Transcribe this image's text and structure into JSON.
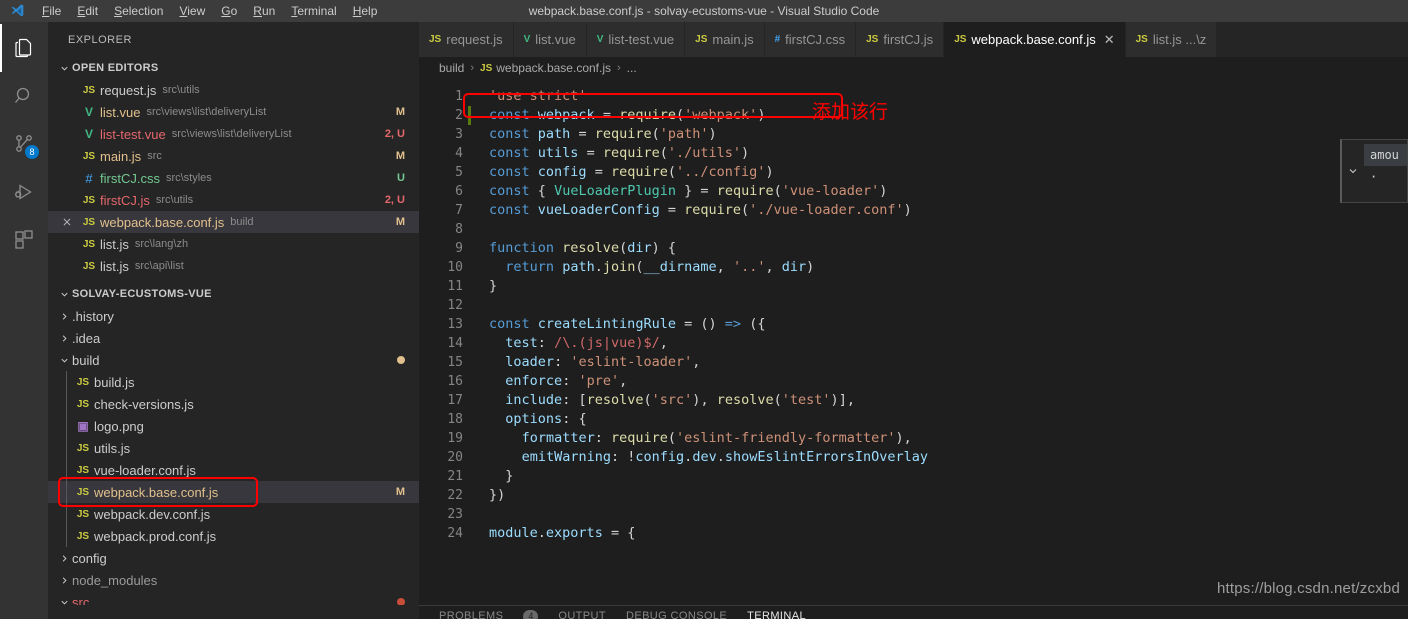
{
  "titlebar": {
    "title": "webpack.base.conf.js - solvay-ecustoms-vue - Visual Studio Code",
    "menus": [
      {
        "label": "File",
        "mnemonic": "F"
      },
      {
        "label": "Edit",
        "mnemonic": "E"
      },
      {
        "label": "Selection",
        "mnemonic": "S"
      },
      {
        "label": "View",
        "mnemonic": "V"
      },
      {
        "label": "Go",
        "mnemonic": "G"
      },
      {
        "label": "Run",
        "mnemonic": "R"
      },
      {
        "label": "Terminal",
        "mnemonic": "T"
      },
      {
        "label": "Help",
        "mnemonic": "H"
      }
    ]
  },
  "activitybar": {
    "items": [
      {
        "name": "explorer-icon",
        "label": "Explorer",
        "active": true,
        "badge": ""
      },
      {
        "name": "search-icon",
        "label": "Search",
        "active": false,
        "badge": ""
      },
      {
        "name": "source-control-icon",
        "label": "Source Control",
        "active": false,
        "badge": "8"
      },
      {
        "name": "run-debug-icon",
        "label": "Run and Debug",
        "active": false,
        "badge": ""
      },
      {
        "name": "extensions-icon",
        "label": "Extensions",
        "active": false,
        "badge": ""
      }
    ]
  },
  "sidebar": {
    "title": "EXPLORER",
    "open_editors": {
      "header": "OPEN EDITORS",
      "items": [
        {
          "icon": "js",
          "name": "request.js",
          "path": "src\\utils",
          "status": "",
          "status_kind": "",
          "name_kind": "",
          "selected": false
        },
        {
          "icon": "vue",
          "name": "list.vue",
          "path": "src\\views\\list\\deliveryList",
          "status": "M",
          "status_kind": "M",
          "name_kind": "mod",
          "selected": false
        },
        {
          "icon": "vue",
          "name": "list-test.vue",
          "path": "src\\views\\list\\deliveryList",
          "status": "2, U",
          "status_kind": "C",
          "name_kind": "conflict",
          "selected": false
        },
        {
          "icon": "js",
          "name": "main.js",
          "path": "src",
          "status": "M",
          "status_kind": "M",
          "name_kind": "mod",
          "selected": false
        },
        {
          "icon": "css",
          "name": "firstCJ.css",
          "path": "src\\styles",
          "status": "U",
          "status_kind": "U",
          "name_kind": "untracked",
          "selected": false
        },
        {
          "icon": "js",
          "name": "firstCJ.js",
          "path": "src\\utils",
          "status": "2, U",
          "status_kind": "C",
          "name_kind": "conflict",
          "selected": false
        },
        {
          "icon": "js",
          "name": "webpack.base.conf.js",
          "path": "build",
          "status": "M",
          "status_kind": "M",
          "name_kind": "mod",
          "selected": true
        },
        {
          "icon": "js",
          "name": "list.js",
          "path": "src\\lang\\zh",
          "status": "",
          "status_kind": "",
          "name_kind": "",
          "selected": false
        },
        {
          "icon": "js",
          "name": "list.js",
          "path": "src\\api\\list",
          "status": "",
          "status_kind": "",
          "name_kind": "",
          "selected": false
        }
      ]
    },
    "project": {
      "header": "SOLVAY-ECUSTOMS-VUE",
      "items": [
        {
          "type": "folder",
          "name": "history_dot_folder",
          "label": ".history",
          "expanded": false,
          "depth": 1,
          "dot": "",
          "name_kind": ""
        },
        {
          "type": "folder",
          "name": "idea-folder",
          "label": ".idea",
          "expanded": false,
          "depth": 1,
          "dot": "",
          "name_kind": ""
        },
        {
          "type": "folder",
          "name": "build-folder",
          "label": "build",
          "expanded": true,
          "depth": 1,
          "dot": "#e2c08d",
          "name_kind": ""
        },
        {
          "type": "file",
          "icon": "js",
          "label": "build.js",
          "depth": 2,
          "status": "",
          "status_kind": "",
          "name_kind": "",
          "selected": false
        },
        {
          "type": "file",
          "icon": "js",
          "label": "check-versions.js",
          "depth": 2,
          "status": "",
          "status_kind": "",
          "name_kind": "",
          "selected": false
        },
        {
          "type": "file",
          "icon": "png",
          "label": "logo.png",
          "depth": 2,
          "status": "",
          "status_kind": "",
          "name_kind": "",
          "selected": false
        },
        {
          "type": "file",
          "icon": "js",
          "label": "utils.js",
          "depth": 2,
          "status": "",
          "status_kind": "",
          "name_kind": "",
          "selected": false
        },
        {
          "type": "file",
          "icon": "js",
          "label": "vue-loader.conf.js",
          "depth": 2,
          "status": "",
          "status_kind": "",
          "name_kind": "",
          "selected": false
        },
        {
          "type": "file",
          "icon": "js",
          "label": "webpack.base.conf.js",
          "depth": 2,
          "status": "M",
          "status_kind": "M",
          "name_kind": "mod",
          "selected": true
        },
        {
          "type": "file",
          "icon": "js",
          "label": "webpack.dev.conf.js",
          "depth": 2,
          "status": "",
          "status_kind": "",
          "name_kind": "",
          "selected": false
        },
        {
          "type": "file",
          "icon": "js",
          "label": "webpack.prod.conf.js",
          "depth": 2,
          "status": "",
          "status_kind": "",
          "name_kind": "",
          "selected": false
        },
        {
          "type": "folder",
          "name": "config-folder",
          "label": "config",
          "expanded": false,
          "depth": 1,
          "dot": "",
          "name_kind": ""
        },
        {
          "type": "folder",
          "name": "node-modules-folder",
          "label": "node_modules",
          "expanded": false,
          "depth": 1,
          "dot": "",
          "name_kind": "dim"
        },
        {
          "type": "folder",
          "name": "src-folder",
          "label": "src",
          "expanded": true,
          "depth": 1,
          "dot": "#c74e39",
          "name_kind": "red"
        }
      ]
    }
  },
  "tabs": [
    {
      "icon": "js",
      "label": "request.js",
      "active": false,
      "close": false
    },
    {
      "icon": "vue",
      "label": "list.vue",
      "active": false,
      "close": false
    },
    {
      "icon": "vue",
      "label": "list-test.vue",
      "active": false,
      "close": false
    },
    {
      "icon": "js",
      "label": "main.js",
      "active": false,
      "close": false
    },
    {
      "icon": "css",
      "label": "firstCJ.css",
      "active": false,
      "close": false
    },
    {
      "icon": "js",
      "label": "firstCJ.js",
      "active": false,
      "close": false
    },
    {
      "icon": "js",
      "label": "webpack.base.conf.js",
      "active": true,
      "close": true
    },
    {
      "icon": "js",
      "label": "list.js ...\\z",
      "active": false,
      "close": false
    }
  ],
  "breadcrumb": {
    "root": "build",
    "file": "webpack.base.conf.js",
    "tail": "...",
    "separator": "›"
  },
  "code": {
    "lines": [
      {
        "n": 1,
        "added": false,
        "text": "'use strict'"
      },
      {
        "n": 2,
        "added": true,
        "text": "const webpack = require('webpack')"
      },
      {
        "n": 3,
        "added": false,
        "text": "const path = require('path')"
      },
      {
        "n": 4,
        "added": false,
        "text": "const utils = require('./utils')"
      },
      {
        "n": 5,
        "added": false,
        "text": "const config = require('../config')"
      },
      {
        "n": 6,
        "added": false,
        "text": "const { VueLoaderPlugin } = require('vue-loader')"
      },
      {
        "n": 7,
        "added": false,
        "text": "const vueLoaderConfig = require('./vue-loader.conf')"
      },
      {
        "n": 8,
        "added": false,
        "text": ""
      },
      {
        "n": 9,
        "added": false,
        "text": "function resolve(dir) {"
      },
      {
        "n": 10,
        "added": false,
        "text": "  return path.join(__dirname, '..', dir)"
      },
      {
        "n": 11,
        "added": false,
        "text": "}"
      },
      {
        "n": 12,
        "added": false,
        "text": ""
      },
      {
        "n": 13,
        "added": false,
        "text": "const createLintingRule = () => ({"
      },
      {
        "n": 14,
        "added": false,
        "text": "  test: /\\.(js|vue)$/,"
      },
      {
        "n": 15,
        "added": false,
        "text": "  loader: 'eslint-loader',"
      },
      {
        "n": 16,
        "added": false,
        "text": "  enforce: 'pre',"
      },
      {
        "n": 17,
        "added": false,
        "text": "  include: [resolve('src'), resolve('test')],"
      },
      {
        "n": 18,
        "added": false,
        "text": "  options: {"
      },
      {
        "n": 19,
        "added": false,
        "text": "    formatter: require('eslint-friendly-formatter'),"
      },
      {
        "n": 20,
        "added": false,
        "text": "    emitWarning: !config.dev.showEslintErrorsInOverlay"
      },
      {
        "n": 21,
        "added": false,
        "text": "  }"
      },
      {
        "n": 22,
        "added": false,
        "text": "})"
      },
      {
        "n": 23,
        "added": false,
        "text": ""
      },
      {
        "n": 24,
        "added": false,
        "text": "module.exports = {"
      }
    ]
  },
  "annotations": {
    "box_code_label": "highlight around line 2",
    "box_tree_label": "highlight around webpack.base.conf.js in tree",
    "note_text": "添加该行",
    "note_color": "#ff0000"
  },
  "suggest": {
    "items": [
      "amou",
      "·"
    ]
  },
  "panel": {
    "tabs": [
      "PROBLEMS",
      "OUTPUT",
      "DEBUG CONSOLE",
      "TERMINAL"
    ],
    "problems_count": "4",
    "active": "TERMINAL"
  },
  "watermark": "https://blog.csdn.net/zcxbd",
  "colors": {
    "accent": "#007acc",
    "modified": "#e2c08d",
    "untracked": "#73c991",
    "conflict": "#e4676b",
    "annotation": "#ff0000",
    "added_gutter": "#587c0c"
  }
}
